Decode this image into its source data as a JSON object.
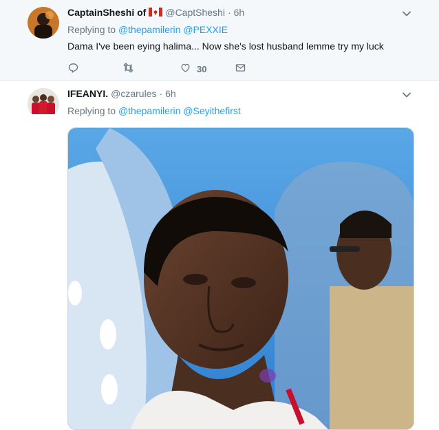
{
  "tweets": [
    {
      "name": "CaptainSheshi of",
      "handle": "@CaptSheshi",
      "separator": "·",
      "time": "6h",
      "replying_prefix": "Replying to",
      "mentions": [
        "@thepamilerin",
        "@PEXXIE"
      ],
      "text": "Dama I've been eying halima... Now she's lost husband lemme try my luck",
      "like_count": "30"
    },
    {
      "name": "IFEANYI.",
      "handle": "@czarules",
      "separator": "·",
      "time": "6h",
      "replying_prefix": "Replying to",
      "mentions": [
        "@thepamilerin",
        "@Seyithefirst"
      ]
    }
  ],
  "icons": {
    "reply": "reply-icon",
    "retweet": "retweet-icon",
    "like": "heart-icon",
    "dm": "envelope-icon",
    "more": "chevron-down-icon",
    "flag": "canada-flag-icon"
  },
  "colors": {
    "link": "#1da1f2",
    "secondary_text": "#657786",
    "primary_text": "#14171a",
    "highlight_bg": "#f5f8fa"
  }
}
